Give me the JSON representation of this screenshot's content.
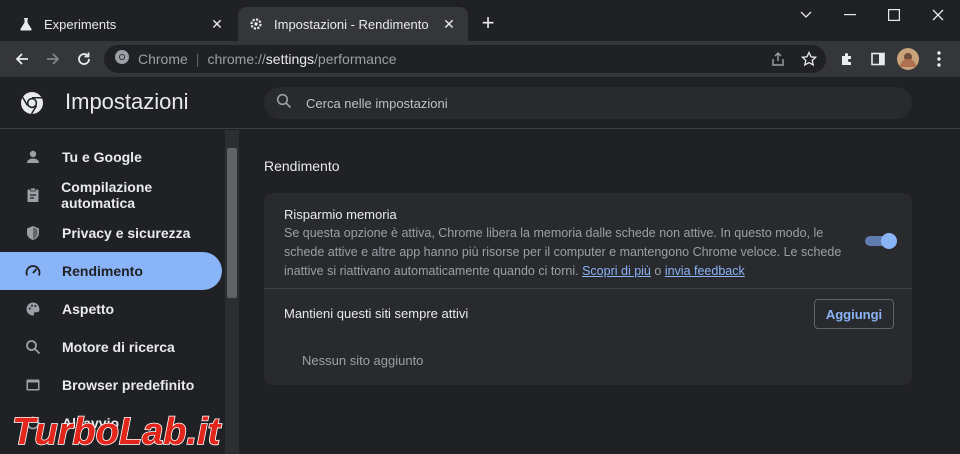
{
  "tabs": [
    {
      "title": "Experiments",
      "icon": "flask-icon"
    },
    {
      "title": "Impostazioni - Rendimento",
      "icon": "gear-icon"
    }
  ],
  "omnibox": {
    "site_label": "Chrome",
    "separator": "|",
    "url_prefix": "chrome://",
    "url_host": "settings",
    "url_path": "/performance"
  },
  "settings": {
    "title": "Impostazioni",
    "search_placeholder": "Cerca nelle impostazioni"
  },
  "sidebar": {
    "items": [
      {
        "label": "Tu e Google",
        "icon": "person-icon"
      },
      {
        "label": "Compilazione automatica",
        "icon": "clipboard-icon"
      },
      {
        "label": "Privacy e sicurezza",
        "icon": "shield-icon"
      },
      {
        "label": "Rendimento",
        "icon": "speedometer-icon",
        "active": true
      },
      {
        "label": "Aspetto",
        "icon": "palette-icon"
      },
      {
        "label": "Motore di ricerca",
        "icon": "search-icon"
      },
      {
        "label": "Browser predefinito",
        "icon": "browser-icon"
      },
      {
        "label": "All'avvio",
        "icon": "power-icon"
      }
    ]
  },
  "main": {
    "section_title": "Rendimento",
    "memory_saver": {
      "title": "Risparmio memoria",
      "description": "Se questa opzione è attiva, Chrome libera la memoria dalle schede non attive. In questo modo, le schede attive e altre app hanno più risorse per il computer e mantengono Chrome veloce. Le schede inattive si riattivano automaticamente quando ci torni.",
      "link_learn": "Scopri di più",
      "link_or": "o",
      "link_feedback": "invia feedback",
      "enabled": true
    },
    "always_active": {
      "label": "Mantieni questi siti sempre attivi",
      "add_button": "Aggiungi",
      "empty_text": "Nessun sito aggiunto"
    }
  },
  "watermark": {
    "text": "TurboLab.it"
  },
  "colors": {
    "accent": "#8ab4f8",
    "background": "#202124",
    "card": "#292a2d",
    "watermark_red": "#e3261b"
  }
}
